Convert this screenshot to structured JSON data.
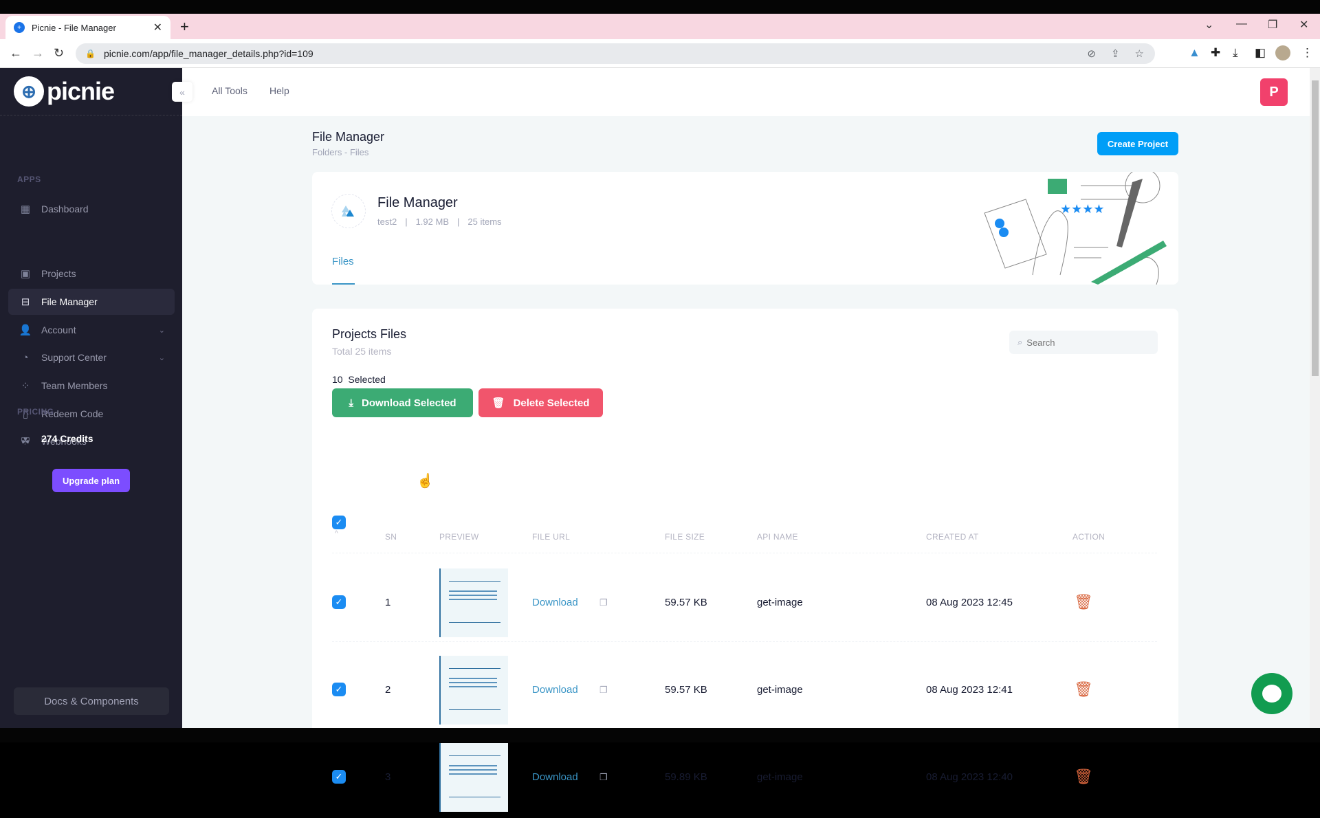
{
  "browser": {
    "tab_title": "Picnie - File Manager",
    "url": "picnie.com/app/file_manager_details.php?id=109"
  },
  "sidebar": {
    "logo_text": "picnie",
    "dashboard": "Dashboard",
    "apps_section": "APPS",
    "items": [
      {
        "label": "Projects",
        "icon": "projects-icon"
      },
      {
        "label": "File Manager",
        "icon": "file-manager-icon",
        "active": true
      },
      {
        "label": "Account",
        "icon": "account-icon",
        "has_submenu": true
      },
      {
        "label": "Support Center",
        "icon": "support-icon",
        "has_submenu": true
      },
      {
        "label": "Team Members",
        "icon": "team-icon"
      },
      {
        "label": "Redeem Code",
        "icon": "redeem-icon"
      },
      {
        "label": "Webhooks",
        "icon": "webhooks-icon"
      }
    ],
    "pricing_section": "PRICING",
    "credits": "274 Credits",
    "upgrade_label": "Upgrade plan",
    "docs_label": "Docs & Components"
  },
  "header": {
    "nav": [
      "All Tools",
      "Help"
    ],
    "user_initial": "P"
  },
  "page": {
    "title": "File Manager",
    "breadcrumb": [
      "Folders",
      "Files"
    ],
    "create_project_label": "Create Project"
  },
  "folder": {
    "name": "File Manager",
    "owner": "test2",
    "size": "1.92 MB",
    "items": "25 items",
    "tabs": [
      "Files"
    ]
  },
  "files": {
    "title": "Projects Files",
    "subtitle": "Total 25 items",
    "search_placeholder": "Search",
    "selected_count": "10",
    "selected_label": "Selected",
    "download_selected": "Download Selected",
    "delete_selected": "Delete Selected",
    "columns": [
      "SN",
      "PREVIEW",
      "FILE URL",
      "FILE SIZE",
      "API NAME",
      "CREATED AT",
      "ACTION"
    ],
    "rows": [
      {
        "sn": "1",
        "url_label": "Download",
        "size": "59.57 KB",
        "api": "get-image",
        "created": "08 Aug 2023 12:45",
        "checked": true
      },
      {
        "sn": "2",
        "url_label": "Download",
        "size": "59.57 KB",
        "api": "get-image",
        "created": "08 Aug 2023 12:41",
        "checked": true
      },
      {
        "sn": "3",
        "url_label": "Download",
        "size": "59.89 KB",
        "api": "get-image",
        "created": "08 Aug 2023 12:40",
        "checked": true
      }
    ]
  },
  "colors": {
    "sidebar_bg": "#1e1e2d",
    "primary": "#009ef7",
    "success": "#3cab74",
    "danger": "#f1556c",
    "upgrade": "#7c4dff",
    "link": "#3a95c6"
  }
}
